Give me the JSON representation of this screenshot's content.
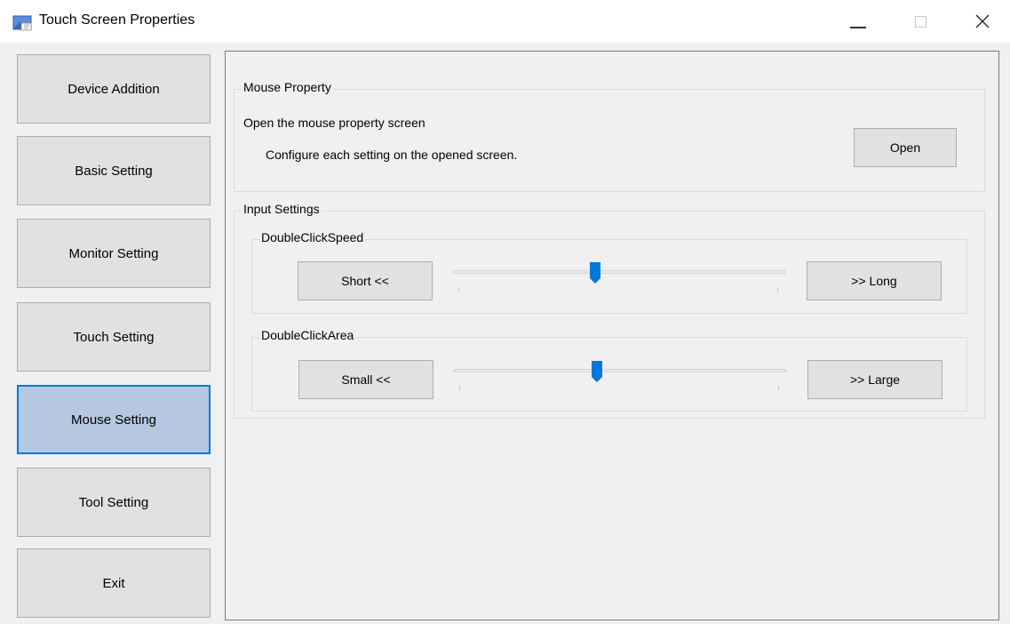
{
  "window": {
    "title": "Touch Screen Properties",
    "accent": "#0078d7"
  },
  "sidebar": {
    "items": [
      {
        "label": "Device Addition"
      },
      {
        "label": "Basic Setting"
      },
      {
        "label": "Monitor Setting"
      },
      {
        "label": "Touch Setting"
      },
      {
        "label": "Mouse Setting",
        "selected": true
      },
      {
        "label": "Tool Setting"
      },
      {
        "label": "Exit"
      }
    ]
  },
  "mouse_property": {
    "group_label": "Mouse Property",
    "description": "Open the mouse property screen",
    "instruction": "Configure each setting on the opened screen.",
    "open_label": "Open"
  },
  "input_settings": {
    "group_label": "Input Settings",
    "double_click_speed": {
      "label": "DoubleClickSpeed",
      "left_button": "Short <<",
      "right_button": ">> Long",
      "value_fraction": 0.43
    },
    "double_click_area": {
      "label": "DoubleClickArea",
      "left_button": "Small <<",
      "right_button": ">> Large",
      "value_fraction": 0.43
    }
  }
}
